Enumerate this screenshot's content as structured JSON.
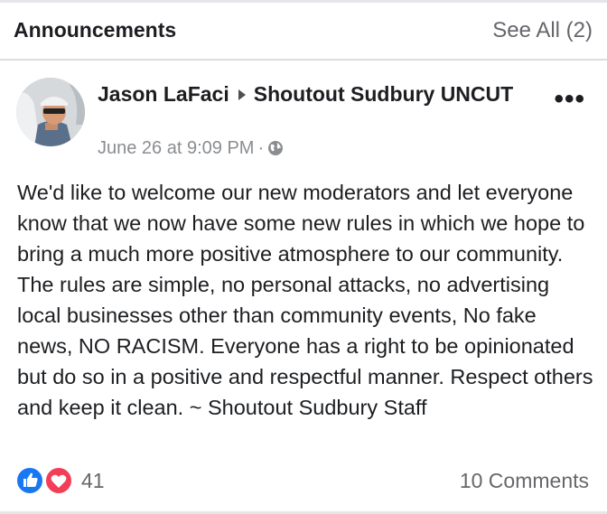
{
  "header": {
    "title": "Announcements",
    "see_all": "See All (2)"
  },
  "post": {
    "author": "Jason LaFaci",
    "group_name": "Shoutout Sudbury UNCUT",
    "timestamp": "June 26 at 9:09 PM",
    "separator": "·",
    "privacy_icon": "globe-icon",
    "more_label": "•••",
    "body": "We'd like to welcome our new moderators and let everyone know that we now have some new rules in which we hope to bring a much more positive atmosphere to our community. The rules are simple, no personal attacks, no advertising local businesses other than community events, No fake news, NO RACISM. Everyone has a right to be opinionated but do so in a positive and respectful manner. Respect others and keep it clean. ~ Shoutout Sudbury Staff"
  },
  "footer": {
    "reaction_icons": [
      "like-icon",
      "love-icon"
    ],
    "reaction_count": "41",
    "comments_label": "10 Comments"
  },
  "colors": {
    "like_blue": "#1877f2",
    "love_red": "#f33e58",
    "muted_text": "#65676b"
  }
}
